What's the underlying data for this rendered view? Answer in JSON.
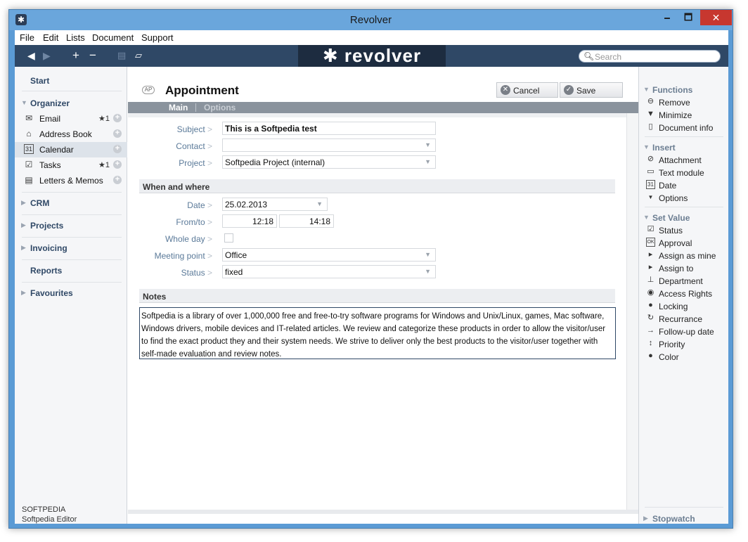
{
  "window": {
    "title": "Revolver",
    "minimize": "🗕",
    "maximize": "🗖",
    "close": "✕"
  },
  "menu": [
    "File",
    "Edit",
    "Lists",
    "Document",
    "Support"
  ],
  "toolbar": {
    "logo": "revolver",
    "search_placeholder": "Search"
  },
  "sidebar": {
    "start": "Start",
    "organizer": "Organizer",
    "items": [
      {
        "label": "Email",
        "badge": "★1"
      },
      {
        "label": "Address Book",
        "badge": ""
      },
      {
        "label": "Calendar",
        "badge": ""
      },
      {
        "label": "Tasks",
        "badge": "★1"
      },
      {
        "label": "Letters & Memos",
        "badge": ""
      }
    ],
    "crm": "CRM",
    "projects": "Projects",
    "invoicing": "Invoicing",
    "reports": "Reports",
    "favourites": "Favourites",
    "footer_company": "SOFTPEDIA",
    "footer_user": "Softpedia Editor"
  },
  "form": {
    "badge": "AP",
    "title": "Appointment",
    "cancel": "Cancel",
    "save": "Save",
    "tabs": [
      "Main",
      "Options"
    ],
    "subject_label": "Subject",
    "subject_value": "This is a Softpedia test",
    "contact_label": "Contact",
    "contact_value": "",
    "project_label": "Project",
    "project_value": "Softpedia Project (internal)",
    "when_where": "When and where",
    "date_label": "Date",
    "date_value": "25.02.2013",
    "fromto_label": "From/to",
    "from_value": "12:18",
    "to_value": "14:18",
    "wholeday_label": "Whole day",
    "meeting_label": "Meeting point",
    "meeting_value": "Office",
    "status_label": "Status",
    "status_value": "fixed",
    "notes_header": "Notes",
    "notes_text": "Softpedia is a library of over 1,000,000 free and free-to-try software programs for Windows and Unix/Linux, games, Mac software, Windows drivers, mobile devices and IT-related articles. We review and categorize these products in order to allow the visitor/user to find the exact product they and their system needs. We strive to deliver only the best products to the visitor/user together with self-made evaluation and review notes."
  },
  "right": {
    "functions": "Functions",
    "remove": "Remove",
    "minimize": "Minimize",
    "docinfo": "Document info",
    "insert": "Insert",
    "attachment": "Attachment",
    "textmodule": "Text module",
    "date": "Date",
    "options": "Options",
    "setvalue": "Set Value",
    "status": "Status",
    "approval": "Approval",
    "assignmine": "Assign as mine",
    "assignto": "Assign to",
    "department": "Department",
    "access": "Access Rights",
    "locking": "Locking",
    "recurrance": "Recurrance",
    "followup": "Follow-up date",
    "priority": "Priority",
    "color": "Color",
    "stopwatch": "Stopwatch"
  }
}
